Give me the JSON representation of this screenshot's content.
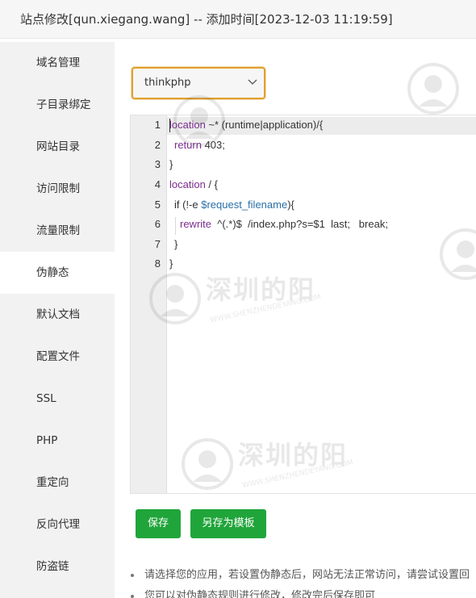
{
  "header": {
    "title": "站点修改[qun.xiegang.wang] -- 添加时间[2023-12-03 11:19:59]"
  },
  "sidebar": {
    "items": [
      {
        "label": "域名管理"
      },
      {
        "label": "子目录绑定"
      },
      {
        "label": "网站目录"
      },
      {
        "label": "访问限制"
      },
      {
        "label": "流量限制"
      },
      {
        "label": "伪静态",
        "active": true
      },
      {
        "label": "默认文档"
      },
      {
        "label": "配置文件"
      },
      {
        "label": "SSL"
      },
      {
        "label": "PHP"
      },
      {
        "label": "重定向"
      },
      {
        "label": "反向代理"
      },
      {
        "label": "防盗链"
      }
    ]
  },
  "rewrite": {
    "selected_template": "thinkphp",
    "line_numbers": [
      "1",
      "2",
      "3",
      "4",
      "5",
      "6",
      "7",
      "8"
    ],
    "code": {
      "l1_kw": "location",
      "l1_rest": " ~* (runtime|application)/{",
      "l2_kw": "return",
      "l2_rest": " 403;",
      "l3": "}",
      "l4_kw": "location",
      "l4_rest": " / {",
      "l5_a": "if",
      "l5_b": " (!-e ",
      "l5_var": "$request_filename",
      "l5_c": "){",
      "l6_kw": "rewrite",
      "l6_rest": "  ^(.*)$  /index.php?s=$1  last;   break;",
      "l7": "}",
      "l8": "}"
    }
  },
  "buttons": {
    "save": "保存",
    "save_as_template": "另存为模板"
  },
  "tips": [
    "请选择您的应用，若设置伪静态后，网站无法正常访问，请尝试设置回",
    "您可以对伪静态规则进行修改，修改完后保存即可"
  ],
  "watermark": {
    "text": "深圳的阳",
    "url": "WWW.SHENZHENDEYANG.COM"
  },
  "colors": {
    "accent": "#20a53a",
    "select_border": "#e0a030",
    "keyword": "#7b2d8e",
    "variable": "#2a6fa8"
  }
}
